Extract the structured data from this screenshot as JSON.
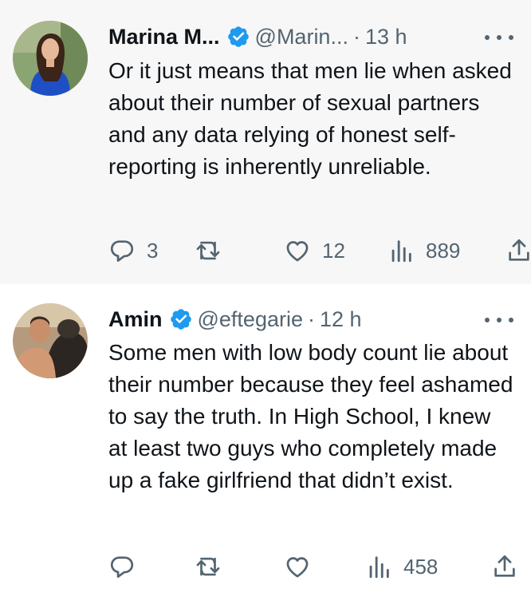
{
  "tweets": [
    {
      "author_name": "Marina M...",
      "handle": "@Marin...",
      "separator": "·",
      "time": "13 h",
      "verified": true,
      "text": "Or it just means that men lie when asked about their number of sexual partners and any data relying of honest self-reporting is inherently unreliable.",
      "replies": "3",
      "retweets": "",
      "likes": "12",
      "views": "889"
    },
    {
      "author_name": "Amin",
      "handle": "@eftegarie",
      "separator": "·",
      "time": "12 h",
      "verified": true,
      "text": "Some men with low body count lie about their number because they feel ashamed to say the truth. In High School, I knew at least two guys who completely made up a fake girlfriend that didn’t exist.",
      "replies": "",
      "retweets": "",
      "likes": "",
      "views": "458"
    }
  ],
  "colors": {
    "text": "#0f1419",
    "secondary": "#536471",
    "verified": "#1d9bf0",
    "thread_line": "#cfd9de",
    "parent_background": "#f7f7f7"
  },
  "icons": [
    "reply-icon",
    "retweet-icon",
    "like-icon",
    "views-icon",
    "share-icon",
    "verified-badge-icon",
    "more-icon"
  ]
}
